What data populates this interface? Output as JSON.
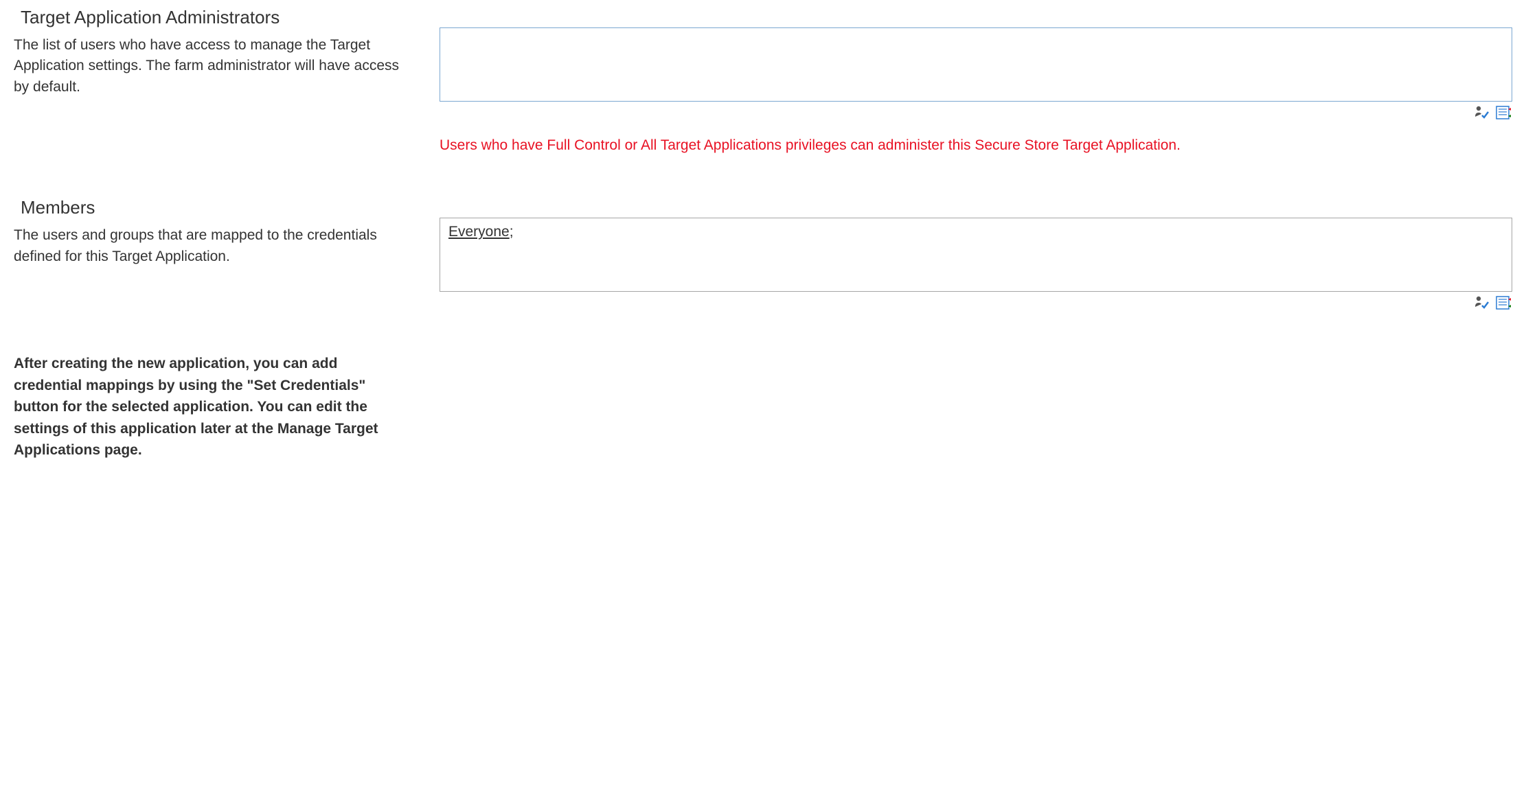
{
  "administrators": {
    "title": "Target Application Administrators",
    "description": "The list of users who have access to manage the Target Application settings. The farm administrator will have access by default.",
    "picker_value": "",
    "validation_message": "Users who have Full Control or All Target Applications privileges can administer this Secure Store Target Application."
  },
  "members": {
    "title": "Members",
    "description": "The users and groups that are mapped to the credentials defined for this Target Application.",
    "resolved_entity": "Everyone",
    "entity_separator": ";"
  },
  "footer_note": "After creating the new application, you can add credential mappings by using the \"Set Credentials\" button for the selected application. You can edit the settings of this application later at the Manage Target Applications page.",
  "icons": {
    "check_names": "check-names-icon",
    "browse": "browse-icon"
  }
}
